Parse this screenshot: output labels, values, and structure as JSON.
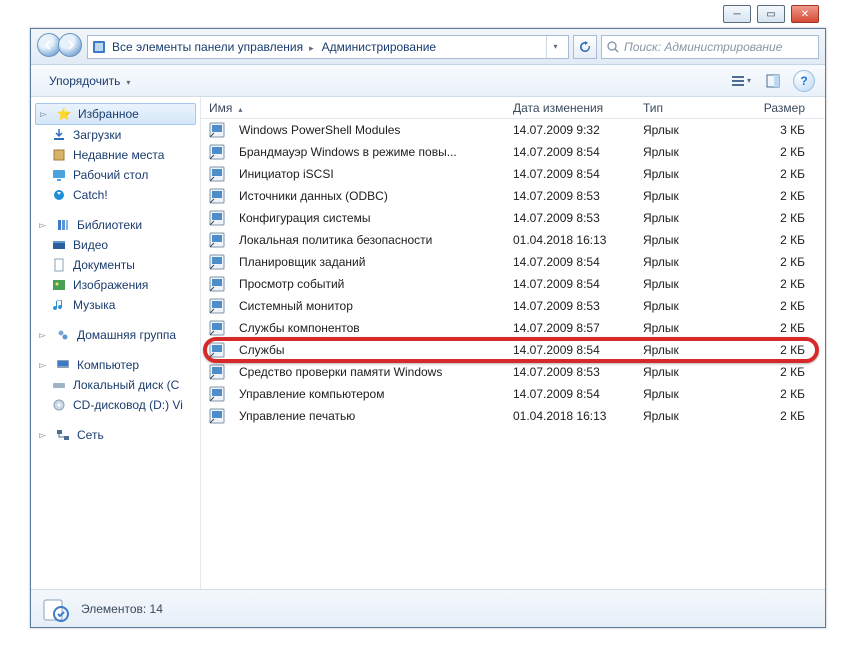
{
  "window": {
    "breadcrumb": [
      "Все элементы панели управления",
      "Администрирование"
    ],
    "search_placeholder": "Поиск: Администрирование"
  },
  "toolbar": {
    "organize": "Упорядочить"
  },
  "sidebar": {
    "favorites": {
      "label": "Избранное",
      "items": [
        "Загрузки",
        "Недавние места",
        "Рабочий стол",
        "Catch!"
      ]
    },
    "libraries": {
      "label": "Библиотеки",
      "items": [
        "Видео",
        "Документы",
        "Изображения",
        "Музыка"
      ]
    },
    "homegroup": {
      "label": "Домашняя группа"
    },
    "computer": {
      "label": "Компьютер",
      "items": [
        "Локальный диск (С",
        "CD-дисковод (D:) Vi"
      ]
    },
    "network": {
      "label": "Сеть"
    }
  },
  "columns": {
    "name": "Имя",
    "date": "Дата изменения",
    "type": "Тип",
    "size": "Размер"
  },
  "files": [
    {
      "name": "Windows PowerShell Modules",
      "date": "14.07.2009 9:32",
      "type": "Ярлык",
      "size": "3 КБ"
    },
    {
      "name": "Брандмауэр Windows в режиме повы...",
      "date": "14.07.2009 8:54",
      "type": "Ярлык",
      "size": "2 КБ"
    },
    {
      "name": "Инициатор iSCSI",
      "date": "14.07.2009 8:54",
      "type": "Ярлык",
      "size": "2 КБ"
    },
    {
      "name": "Источники данных (ODBC)",
      "date": "14.07.2009 8:53",
      "type": "Ярлык",
      "size": "2 КБ"
    },
    {
      "name": "Конфигурация системы",
      "date": "14.07.2009 8:53",
      "type": "Ярлык",
      "size": "2 КБ"
    },
    {
      "name": "Локальная политика безопасности",
      "date": "01.04.2018 16:13",
      "type": "Ярлык",
      "size": "2 КБ"
    },
    {
      "name": "Планировщик заданий",
      "date": "14.07.2009 8:54",
      "type": "Ярлык",
      "size": "2 КБ"
    },
    {
      "name": "Просмотр событий",
      "date": "14.07.2009 8:54",
      "type": "Ярлык",
      "size": "2 КБ"
    },
    {
      "name": "Системный монитор",
      "date": "14.07.2009 8:53",
      "type": "Ярлык",
      "size": "2 КБ"
    },
    {
      "name": "Службы компонентов",
      "date": "14.07.2009 8:57",
      "type": "Ярлык",
      "size": "2 КБ"
    },
    {
      "name": "Службы",
      "date": "14.07.2009 8:54",
      "type": "Ярлык",
      "size": "2 КБ",
      "highlight": true
    },
    {
      "name": "Средство проверки памяти Windows",
      "date": "14.07.2009 8:53",
      "type": "Ярлык",
      "size": "2 КБ"
    },
    {
      "name": "Управление компьютером",
      "date": "14.07.2009 8:54",
      "type": "Ярлык",
      "size": "2 КБ"
    },
    {
      "name": "Управление печатью",
      "date": "01.04.2018 16:13",
      "type": "Ярлык",
      "size": "2 КБ"
    }
  ],
  "status": {
    "count_label": "Элементов: 14"
  }
}
